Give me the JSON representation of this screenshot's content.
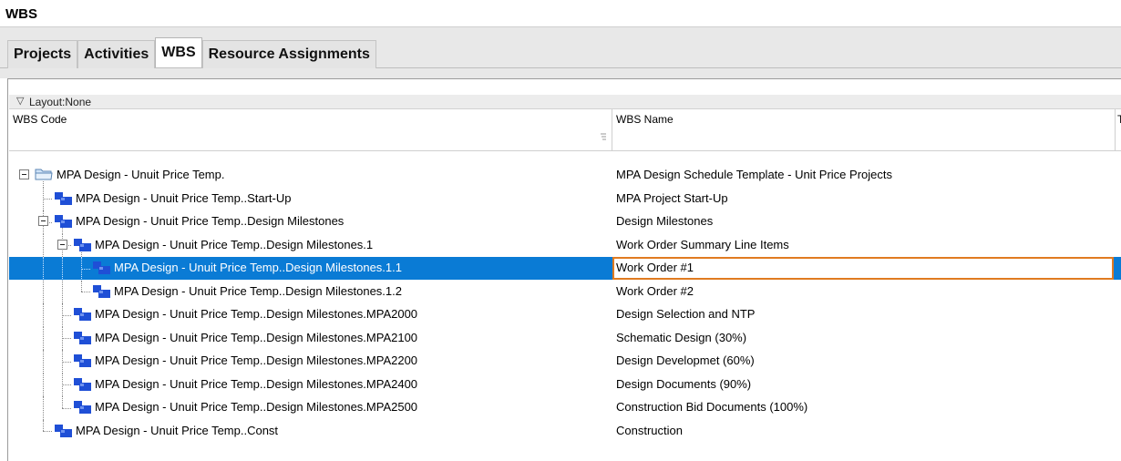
{
  "window": {
    "title": "WBS"
  },
  "tabs": [
    {
      "label": "Projects",
      "active": false
    },
    {
      "label": "Activities",
      "active": false
    },
    {
      "label": "WBS",
      "active": true
    },
    {
      "label": "Resource Assignments",
      "active": false
    }
  ],
  "layout": {
    "label": "Layout:None"
  },
  "columns": {
    "code": "WBS Code",
    "name": "WBS Name",
    "next": "T"
  },
  "colors": {
    "selection": "#0a7bd5",
    "focus_border": "#e07b21",
    "wbs_icon": "#1f4fd6"
  },
  "rows": [
    {
      "code": "MPA Design - Unuit Price Temp.",
      "name": "MPA Design Schedule Template - Unit Price Projects",
      "level": 0,
      "icon": "folder-icon",
      "expandable": true
    },
    {
      "code": "MPA Design - Unuit Price Temp..Start-Up",
      "name": "MPA Project Start-Up",
      "level": 1,
      "icon": "wbs-icon",
      "expandable": false
    },
    {
      "code": "MPA Design - Unuit Price Temp..Design Milestones",
      "name": "Design Milestones",
      "level": 1,
      "icon": "wbs-icon",
      "expandable": true
    },
    {
      "code": "MPA Design - Unuit Price Temp..Design Milestones.1",
      "name": "Work Order Summary Line Items",
      "level": 2,
      "icon": "wbs-icon",
      "expandable": true
    },
    {
      "code": "MPA Design - Unuit Price Temp..Design Milestones.1.1",
      "name": "Work Order #1",
      "level": 3,
      "icon": "wbs-icon",
      "expandable": false,
      "selected": true
    },
    {
      "code": "MPA Design - Unuit Price Temp..Design Milestones.1.2",
      "name": "Work Order #2",
      "level": 3,
      "icon": "wbs-icon",
      "expandable": false
    },
    {
      "code": "MPA Design - Unuit Price Temp..Design Milestones.MPA2000",
      "name": "Design Selection and NTP",
      "level": 2,
      "icon": "wbs-icon",
      "expandable": false
    },
    {
      "code": "MPA Design - Unuit Price Temp..Design Milestones.MPA2100",
      "name": "Schematic Design (30%)",
      "level": 2,
      "icon": "wbs-icon",
      "expandable": false
    },
    {
      "code": "MPA Design - Unuit Price Temp..Design Milestones.MPA2200",
      "name": "Design Developmet (60%)",
      "level": 2,
      "icon": "wbs-icon",
      "expandable": false
    },
    {
      "code": "MPA Design - Unuit Price Temp..Design Milestones.MPA2400",
      "name": "Design Documents (90%)",
      "level": 2,
      "icon": "wbs-icon",
      "expandable": false
    },
    {
      "code": "MPA Design - Unuit Price Temp..Design Milestones.MPA2500",
      "name": "Construction Bid Documents (100%)",
      "level": 2,
      "icon": "wbs-icon",
      "expandable": false
    },
    {
      "code": "MPA Design - Unuit Price Temp..Const",
      "name": "Construction",
      "level": 1,
      "icon": "wbs-icon",
      "expandable": false
    }
  ]
}
